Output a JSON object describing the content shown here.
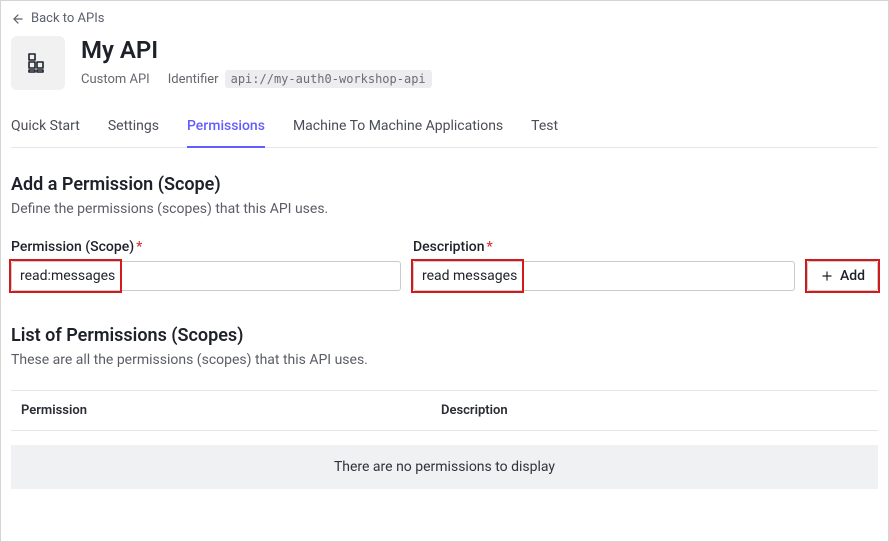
{
  "back_link": {
    "label": "Back to APIs"
  },
  "header": {
    "title": "My API",
    "type_label": "Custom API",
    "identifier_label": "Identifier",
    "identifier_value": "api://my-auth0-workshop-api"
  },
  "tabs": [
    {
      "label": "Quick Start",
      "active": false
    },
    {
      "label": "Settings",
      "active": false
    },
    {
      "label": "Permissions",
      "active": true
    },
    {
      "label": "Machine To Machine Applications",
      "active": false
    },
    {
      "label": "Test",
      "active": false
    }
  ],
  "add_section": {
    "title": "Add a Permission (Scope)",
    "description": "Define the permissions (scopes) that this API uses.",
    "permission_label": "Permission (Scope)",
    "description_label": "Description",
    "permission_value": "read:messages",
    "description_value": "read messages",
    "add_button_label": "Add"
  },
  "list_section": {
    "title": "List of Permissions (Scopes)",
    "description": "These are all the permissions (scopes) that this API uses.",
    "columns": {
      "permission": "Permission",
      "description": "Description"
    },
    "empty_message": "There are no permissions to display"
  }
}
